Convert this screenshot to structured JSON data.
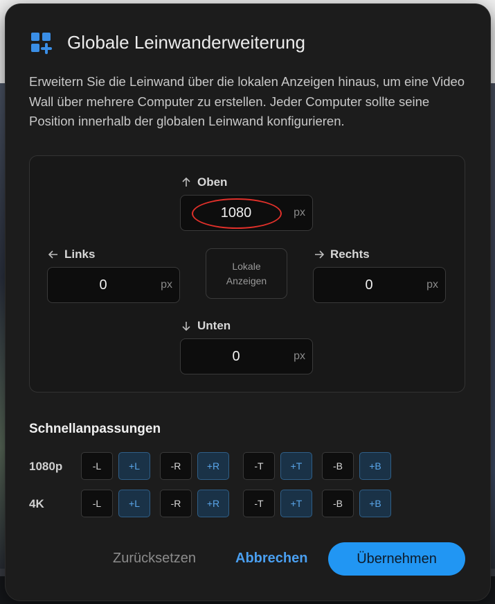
{
  "dialog": {
    "title": "Globale Leinwanderweiterung",
    "description": "Erweitern Sie die Leinwand über die lokalen Anzeigen hinaus, um eine Video Wall über mehrere Computer zu erstellen. Jeder Computer sollte seine Position innerhalb der globalen Leinwand konfigurieren.",
    "icon": "grid-plus-icon",
    "accent": "#2196f3"
  },
  "extension": {
    "top": {
      "label": "Oben",
      "value": "1080",
      "unit": "px"
    },
    "left": {
      "label": "Links",
      "value": "0",
      "unit": "px"
    },
    "right": {
      "label": "Rechts",
      "value": "0",
      "unit": "px"
    },
    "bottom": {
      "label": "Unten",
      "value": "0",
      "unit": "px"
    },
    "local_line1": "Lokale",
    "local_line2": "Anzeigen"
  },
  "quick": {
    "title": "Schnellanpassungen",
    "rows": [
      {
        "label": "1080p",
        "buttons": [
          "-L",
          "+L",
          "-R",
          "+R",
          "-T",
          "+T",
          "-B",
          "+B"
        ]
      },
      {
        "label": "4K",
        "buttons": [
          "-L",
          "+L",
          "-R",
          "+R",
          "-T",
          "+T",
          "-B",
          "+B"
        ]
      }
    ]
  },
  "actions": {
    "reset": "Zurücksetzen",
    "cancel": "Abbrechen",
    "apply": "Übernehmen"
  }
}
